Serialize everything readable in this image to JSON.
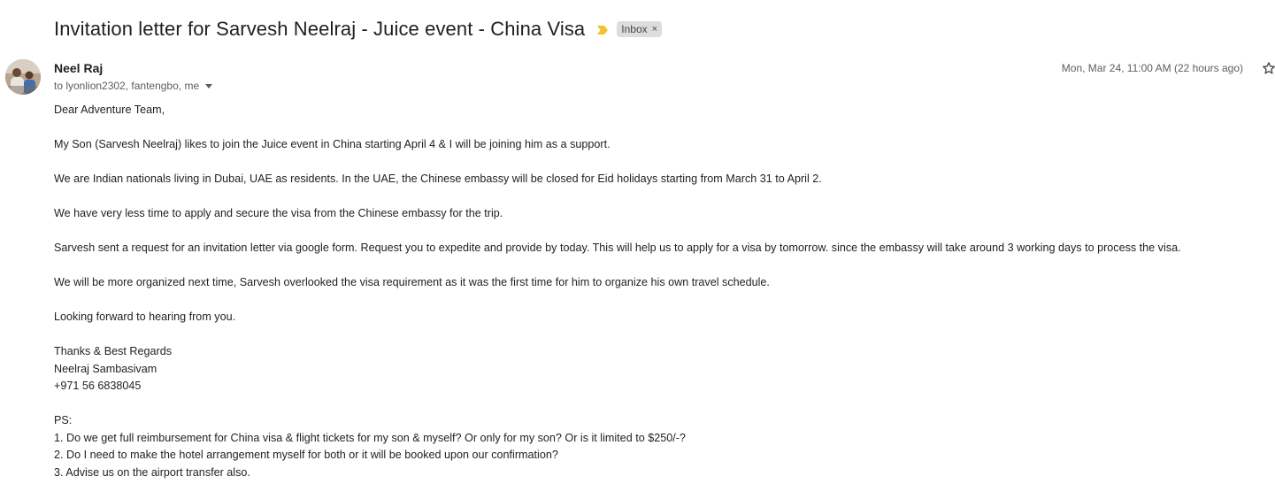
{
  "email": {
    "subject": "Invitation letter for Sarvesh Neelraj - Juice event - China Visa",
    "label": "Inbox",
    "label_remove": "×",
    "sender_name": "Neel Raj",
    "recipients": "to lyonlion2302, fantengbo, me",
    "timestamp": "Mon, Mar 24, 11:00 AM (22 hours ago)",
    "colors": {
      "important_marker": "#f2c12e",
      "label_bg": "#dddddd"
    },
    "icons": {
      "star": "star-icon",
      "important": "important-marker-icon",
      "recipients_toggle": "caret-down-icon"
    },
    "body": {
      "greeting": "Dear Adventure Team,",
      "p1": "My Son (Sarvesh Neelraj) likes to join the Juice event in China starting April 4 & I will be joining him as a support.",
      "p2": "We are Indian nationals living in Dubai, UAE as residents. In the UAE, the Chinese embassy will be closed for Eid holidays starting from March 31 to April 2.",
      "p3": "We have very less time to apply and secure the visa from the Chinese embassy for the trip.",
      "p4": "Sarvesh sent a request for an invitation letter via  google form. Request you to expedite and provide by today. This will help us to apply for a visa by tomorrow. since the embassy will take around 3 working days to process the visa.",
      "p5": "We will be more organized next time, Sarvesh overlooked the visa requirement as it was the first time for him to organize his own travel schedule.",
      "p6": "Looking forward to hearing from you.",
      "sign_regards": "Thanks & Best Regards",
      "sign_name": "Neelraj Sambasivam",
      "sign_phone": "+971 56 6838045",
      "ps_heading": "PS:",
      "ps_1": "1. Do we get full reimbursement for China visa & flight tickets for my son & myself? Or only for my son? Or is it limited to $250/-?",
      "ps_2": "2. Do I need to make the hotel arrangement myself for both or it will be booked upon our confirmation?",
      "ps_3": "3. Advise us on the airport transfer also."
    }
  }
}
